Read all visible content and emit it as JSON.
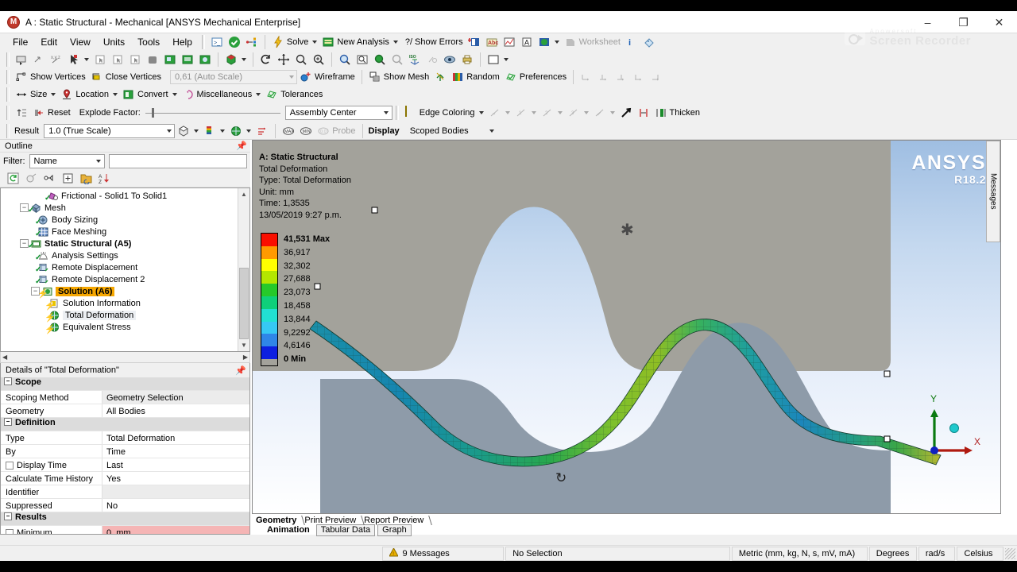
{
  "window": {
    "title": "A : Static Structural - Mechanical [ANSYS Mechanical Enterprise]",
    "app_letter": "M",
    "minimize": "–",
    "maximize": "❐",
    "close": "✕"
  },
  "watermark": {
    "line1": "Apowersoft",
    "line2": "Screen Recorder"
  },
  "menu": [
    "File",
    "Edit",
    "View",
    "Units",
    "Tools",
    "Help"
  ],
  "toolbar_main": {
    "solve": "Solve",
    "new_analysis": "New Analysis",
    "show_errors": "?/ Show Errors",
    "worksheet": "Worksheet"
  },
  "toolbar_vertices": {
    "show_vertices": "Show Vertices",
    "close_vertices": "Close Vertices",
    "auto_scale": "0,61 (Auto Scale)",
    "wireframe": "Wireframe",
    "show_mesh": "Show Mesh",
    "random": "Random",
    "preferences": "Preferences"
  },
  "toolbar_size": {
    "size": "Size",
    "location": "Location",
    "convert": "Convert",
    "miscellaneous": "Miscellaneous",
    "tolerances": "Tolerances"
  },
  "toolbar_explode": {
    "reset": "Reset",
    "explode_factor": "Explode Factor:",
    "assembly_center": "Assembly Center",
    "edge_coloring": "Edge Coloring",
    "thicken": "Thicken"
  },
  "toolbar_result": {
    "result": "Result",
    "scale": "1.0 (True Scale)",
    "probe": "Probe",
    "display": "Display",
    "scoped_bodies": "Scoped Bodies"
  },
  "outline": {
    "title": "Outline",
    "filter_label": "Filter:",
    "filter_value": "Name",
    "filter_text": "",
    "tree": [
      {
        "label": "Frictional - Solid1 To Solid1",
        "indent": 4,
        "icon": "contact-icon",
        "state": "check",
        "expander": "none",
        "style": "normal"
      },
      {
        "label": "Mesh",
        "indent": 1,
        "icon": "mesh-icon",
        "state": "check",
        "expander": "minus",
        "style": "normal"
      },
      {
        "label": "Body Sizing",
        "indent": 3,
        "icon": "sizing-icon",
        "state": "check",
        "expander": "none",
        "style": "normal"
      },
      {
        "label": "Face Meshing",
        "indent": 3,
        "icon": "facemesh-icon",
        "state": "check",
        "expander": "none",
        "style": "normal"
      },
      {
        "label": "Static Structural (A5)",
        "indent": 1,
        "icon": "branch-icon",
        "state": "check",
        "expander": "minus",
        "style": "bold"
      },
      {
        "label": "Analysis Settings",
        "indent": 3,
        "icon": "settings-icon",
        "state": "check",
        "expander": "none",
        "style": "normal"
      },
      {
        "label": "Remote Displacement",
        "indent": 3,
        "icon": "remote-icon",
        "state": "check",
        "expander": "none",
        "style": "normal"
      },
      {
        "label": "Remote Displacement 2",
        "indent": 3,
        "icon": "remote-icon",
        "state": "check",
        "expander": "none",
        "style": "normal"
      },
      {
        "label": "Solution (A6)",
        "indent": 2,
        "icon": "solution-icon",
        "state": "bolt",
        "expander": "minus",
        "style": "selected"
      },
      {
        "label": "Solution Information",
        "indent": 4,
        "icon": "info-icon",
        "state": "bolt",
        "expander": "none",
        "style": "normal"
      },
      {
        "label": "Total Deformation",
        "indent": 4,
        "icon": "result-icon",
        "state": "bolt",
        "expander": "none",
        "style": "highlight"
      },
      {
        "label": "Equivalent Stress",
        "indent": 4,
        "icon": "result-icon",
        "state": "bolt",
        "expander": "none",
        "style": "normal"
      }
    ]
  },
  "details": {
    "title": "Details of \"Total Deformation\"",
    "rows": [
      {
        "kind": "group",
        "label": "Scope",
        "value": ""
      },
      {
        "kind": "row",
        "label": "Scoping Method",
        "value": "Geometry Selection",
        "shade": true
      },
      {
        "kind": "row",
        "label": "Geometry",
        "value": "All Bodies",
        "shade": false
      },
      {
        "kind": "group",
        "label": "Definition",
        "value": ""
      },
      {
        "kind": "row",
        "label": "Type",
        "value": "Total Deformation",
        "shade": false
      },
      {
        "kind": "row",
        "label": "By",
        "value": "Time",
        "shade": false
      },
      {
        "kind": "check",
        "label": "Display Time",
        "value": "Last",
        "shade": false
      },
      {
        "kind": "row",
        "label": "Calculate Time History",
        "value": "Yes",
        "shade": false
      },
      {
        "kind": "row",
        "label": "Identifier",
        "value": "",
        "shade": true
      },
      {
        "kind": "row",
        "label": "Suppressed",
        "value": "No",
        "shade": false
      },
      {
        "kind": "group",
        "label": "Results",
        "value": ""
      },
      {
        "kind": "check",
        "label": "Minimum",
        "value": "0, mm",
        "pink": true
      }
    ]
  },
  "viewport": {
    "result_header": {
      "title": "A: Static Structural",
      "name": "Total Deformation",
      "type": "Type: Total Deformation",
      "unit": "Unit: mm",
      "time": "Time: 1,3535",
      "stamp": "13/05/2019 9:27 p.m."
    },
    "legend": {
      "labels": [
        "41,531 Max",
        "36,917",
        "32,302",
        "27,688",
        "23,073",
        "18,458",
        "13,844",
        "9,2292",
        "4,6146",
        "0 Min"
      ],
      "colors": [
        "#fa0f00",
        "#ff9a00",
        "#ffff00",
        "#b4e600",
        "#26c92a",
        "#0fd07a",
        "#22e0d2",
        "#36c8f4",
        "#2f86e8",
        "#0d1fe0"
      ]
    },
    "brand": {
      "name": "ANSYS",
      "release": "R18.2"
    },
    "triad": {
      "y": "Y",
      "x": "X"
    },
    "messages_tab": "Messages",
    "tabs_top": [
      "Geometry",
      "Print Preview",
      "Report Preview"
    ],
    "tabs_bottom": [
      "Animation",
      "Tabular Data",
      "Graph"
    ],
    "active_top": "Geometry",
    "active_bottom": "Animation"
  },
  "statusbar": {
    "messages": "9 Messages",
    "selection": "No Selection",
    "units": "Metric (mm, kg, N, s, mV, mA)",
    "angle": "Degrees",
    "rotation": "rad/s",
    "temperature": "Celsius"
  },
  "colors": {
    "accent": "#f6a700",
    "solid_upper": "#a0a09a",
    "solid_lower": "#8b98a6",
    "beam_max": "#fa0f00"
  }
}
